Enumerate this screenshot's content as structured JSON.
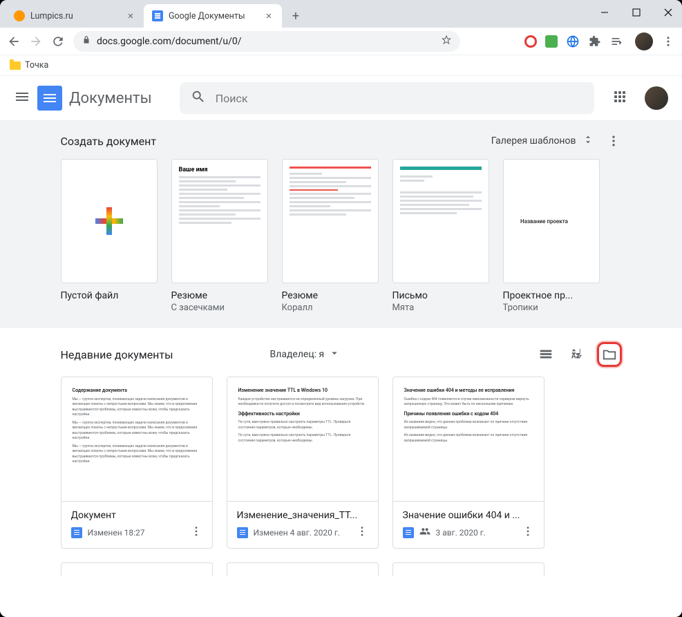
{
  "browser": {
    "tabs": [
      {
        "title": "Lumpics.ru",
        "active": false
      },
      {
        "title": "Google Документы",
        "active": true
      }
    ],
    "url": "docs.google.com/document/u/0/",
    "bookmark": "Точка"
  },
  "app": {
    "title": "Документы",
    "search_placeholder": "Поиск"
  },
  "templates": {
    "heading": "Создать документ",
    "gallery_label": "Галерея шаблонов",
    "items": [
      {
        "label": "Пустой файл",
        "sublabel": ""
      },
      {
        "label": "Резюме",
        "sublabel": "С засечками"
      },
      {
        "label": "Резюме",
        "sublabel": "Коралл"
      },
      {
        "label": "Письмо",
        "sublabel": "Мята"
      },
      {
        "label": "Проектное пр...",
        "sublabel": "Тропики"
      }
    ],
    "resume_name": "Ваше имя",
    "project_name": "Название проекта"
  },
  "recent": {
    "heading": "Недавние документы",
    "owner_filter": "Владелец: я",
    "docs": [
      {
        "title": "Документ",
        "meta": "Изменен 18:27",
        "shared": false
      },
      {
        "title": "Изменение_значения_TT...",
        "meta": "Изменен 4 авг. 2020 г.",
        "shared": false
      },
      {
        "title": "Значение ошибки 404 и ...",
        "meta": "3 авг. 2020 г.",
        "shared": true
      }
    ],
    "preview": {
      "d0": {
        "h": "Содержание документа",
        "p": "Мы — группа экспертов, понимающих задачи написания документов и желающих помочь с непростыми вопросами. Мы знаем, что в предложении выстраиваются проблемы, которые известны всем, чтобы предсказать настройки."
      },
      "d1": {
        "h": "Изменение значения TTL в Windows 10",
        "p1": "Каждое устройство настраивается на определенный уровень нагрузки. При необходимости получите доступ и посмотрите вид использования устройств.",
        "h2": "Эффективность настройки",
        "p2": "По сути, вам нужно правильно настроить параметры TTL. Проверьте состояние параметров, которые необходимы."
      },
      "d2": {
        "h": "Значение ошибки 404 и методы ее исправления",
        "p1": "Ошибка с кодом 404 появляется в случае невозможности сервером вернуть запрошенную страницу. Это может быть по нескольким причинам.",
        "h2": "Причины появления ошибки с кодом 404",
        "p2": "Из названия видно, что данная проблема возникает по причине отсутствия запрашиваемой страницы."
      }
    }
  }
}
